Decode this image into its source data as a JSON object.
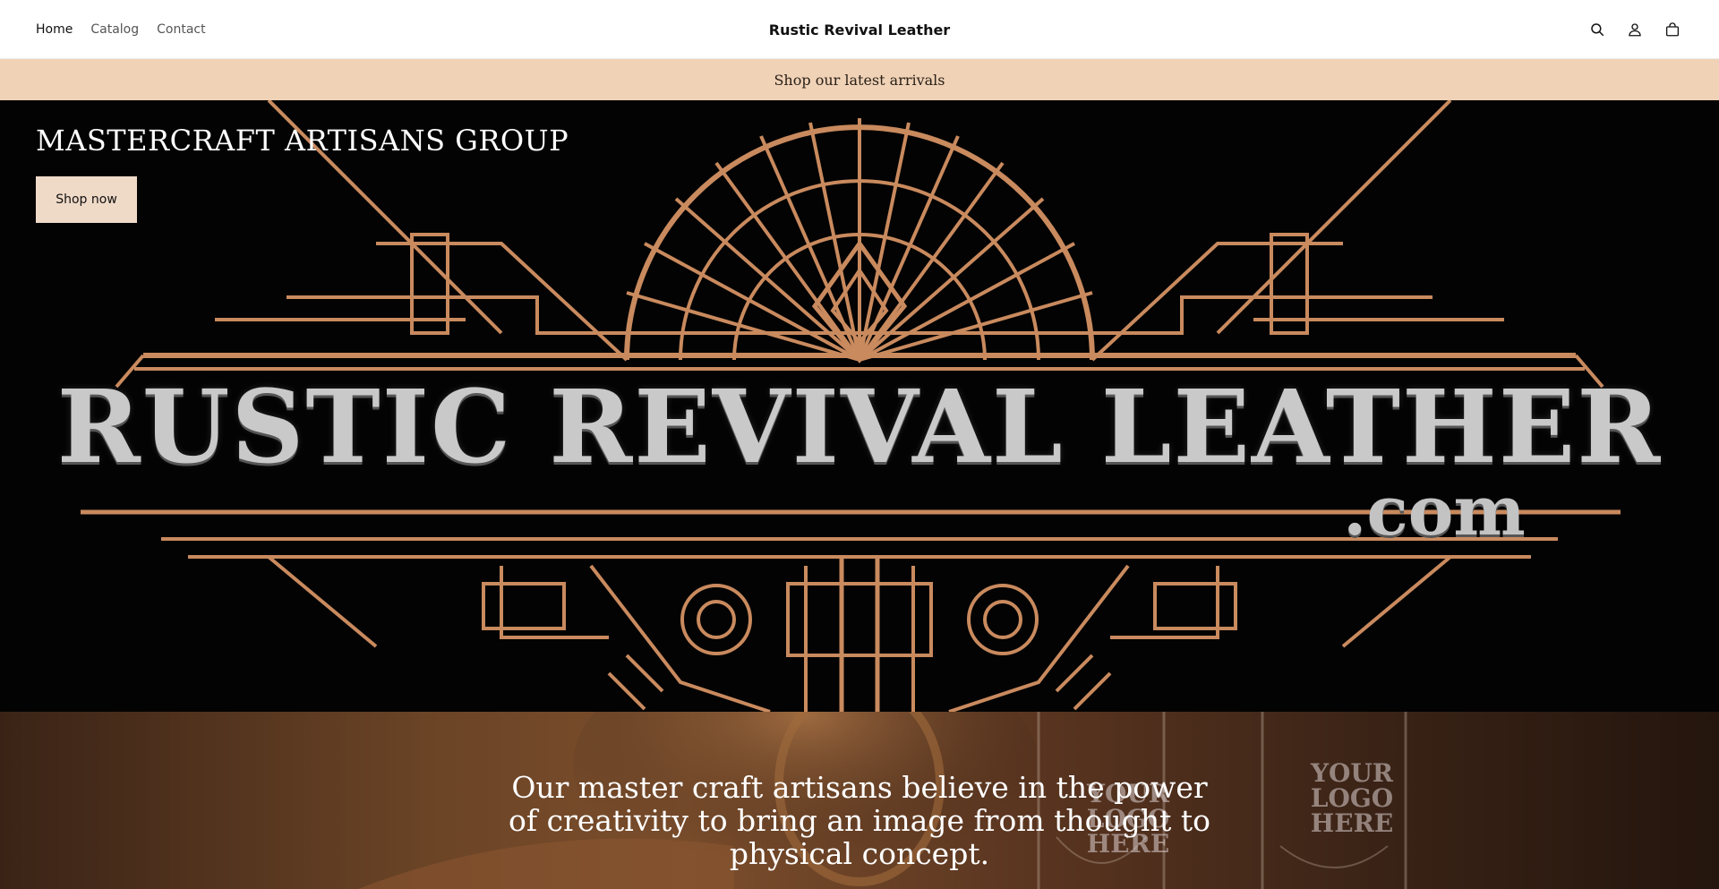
{
  "header": {
    "nav": [
      {
        "label": "Home",
        "active": true
      },
      {
        "label": "Catalog",
        "active": false
      },
      {
        "label": "Contact",
        "active": false
      }
    ],
    "brand": "Rustic Revival Leather",
    "icons": [
      "search-icon",
      "account-icon",
      "cart-icon"
    ]
  },
  "announcement": {
    "text": "Shop our latest arrivals"
  },
  "hero": {
    "title": "MASTERCRAFT ARTISANS GROUP",
    "button_label": "Shop now",
    "logo_text": "RUSTIC REVIVAL LEATHER",
    "logo_suffix": ".com"
  },
  "story": {
    "text": "Our master craft artisans believe in the power of creativity to bring an image from thought to physical concept.",
    "glass_labels": [
      "YOUR LOGO HERE",
      "YOUR LOGO HERE"
    ]
  },
  "colors": {
    "announcement_bg": "#f0d2b6",
    "button_bg": "#efd9c7",
    "accent_copper": "#c98a5e",
    "hero_bg": "#030303"
  }
}
